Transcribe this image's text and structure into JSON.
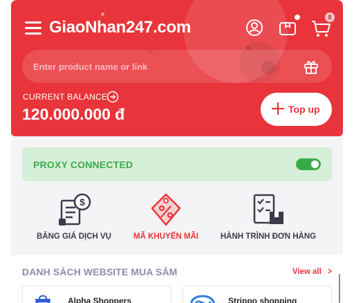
{
  "header": {
    "logo_text": "GiaoNhan247.com",
    "cart_count": "8",
    "brand_color": "#e8343a"
  },
  "search": {
    "placeholder": "Enter product name or link",
    "value": ""
  },
  "balance": {
    "label": "CURRENT BALANCE",
    "value": "120.000.000 đ"
  },
  "topup": {
    "label": "Top up"
  },
  "proxy": {
    "label": "PROXY CONNECTED",
    "enabled": true,
    "color": "#3bab4a"
  },
  "features": [
    {
      "label": "BẢNG GIÁ DỊCH VỤ",
      "icon": "price-list-icon",
      "active": false
    },
    {
      "label": "MÃ KHUYẾN MÃI",
      "icon": "discount-tag-icon",
      "active": true
    },
    {
      "label": "HÀNH TRÌNH ĐƠN HÀNG",
      "icon": "order-journey-icon",
      "active": false
    }
  ],
  "websites": {
    "title": "DANH SÁCH WEBSITE MUA SẮM",
    "view_all": "View all",
    "items": [
      {
        "name": "Alpha Shoppers",
        "icon": "alpha-shoppers-logo"
      },
      {
        "name": "Strippo shopping",
        "icon": "strippo-logo"
      }
    ]
  }
}
